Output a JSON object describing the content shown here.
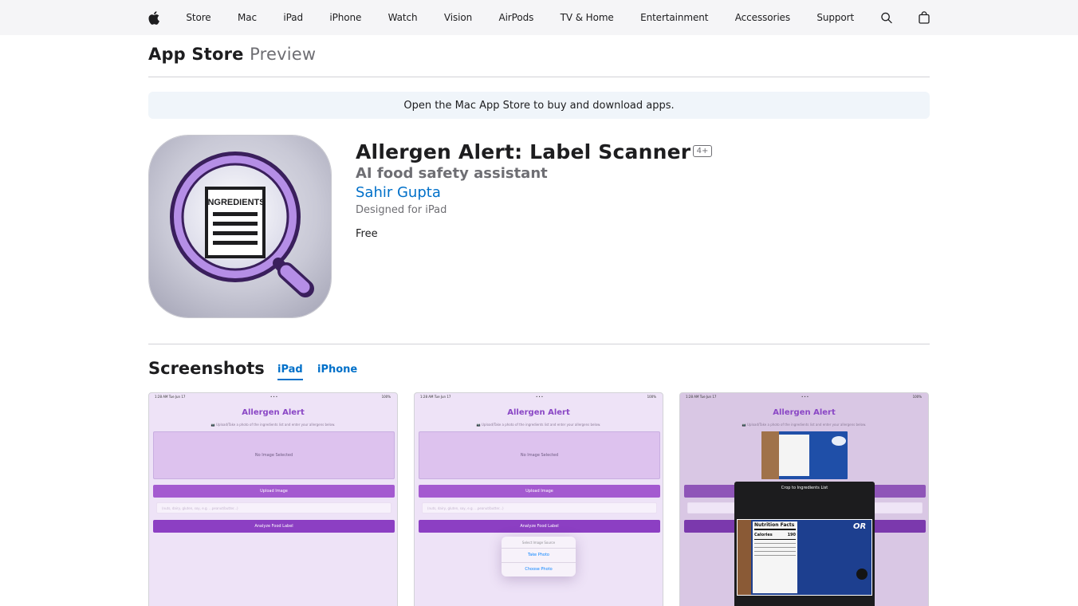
{
  "nav": {
    "items": [
      "Store",
      "Mac",
      "iPad",
      "iPhone",
      "Watch",
      "Vision",
      "AirPods",
      "TV & Home",
      "Entertainment",
      "Accessories",
      "Support"
    ],
    "icons": [
      "apple-logo",
      "search-icon",
      "bag-icon"
    ]
  },
  "localnav": {
    "title": "App Store",
    "subtitle": "Preview"
  },
  "banner": "Open the Mac App Store to buy and download apps.",
  "app": {
    "title": "Allergen Alert: Label Scanner",
    "age_rating": "4+",
    "subtitle": "AI food safety assistant",
    "developer": "Sahir Gupta",
    "designed_for": "Designed for iPad",
    "price": "Free",
    "icon_label": "INGREDIENTS"
  },
  "screenshots": {
    "heading": "Screenshots",
    "tabs": [
      "iPad",
      "iPhone"
    ],
    "active_tab": "iPad",
    "status_time": "1:28 AM  Tue Jun 17",
    "status_right": "100%",
    "app_title": "Allergen Alert",
    "instruction": "📷 Upload/Take a photo of the ingredients list and enter your allergens below.",
    "no_image": "No Image Selected",
    "upload_button": "Upload Image",
    "field_placeholder": "(nuts, dairy, gluten, soy, e.g. ...peanut/butter...)",
    "analyze_button": "Analyze Food Label",
    "popover": {
      "title": "Select Image Source",
      "take": "Take Photo",
      "choose": "Choose Photo"
    },
    "crop_title": "Crop to Ingredients List",
    "label_heading": "Nutrition Facts",
    "label_calories": "Calories",
    "label_calories_value": "190",
    "label_brand": "OR"
  },
  "colors": {
    "nav_bg": "#f5f5f7",
    "link": "#0070c9",
    "banner_bg": "#f0f5fa",
    "app_purple": "#8a47c5"
  }
}
